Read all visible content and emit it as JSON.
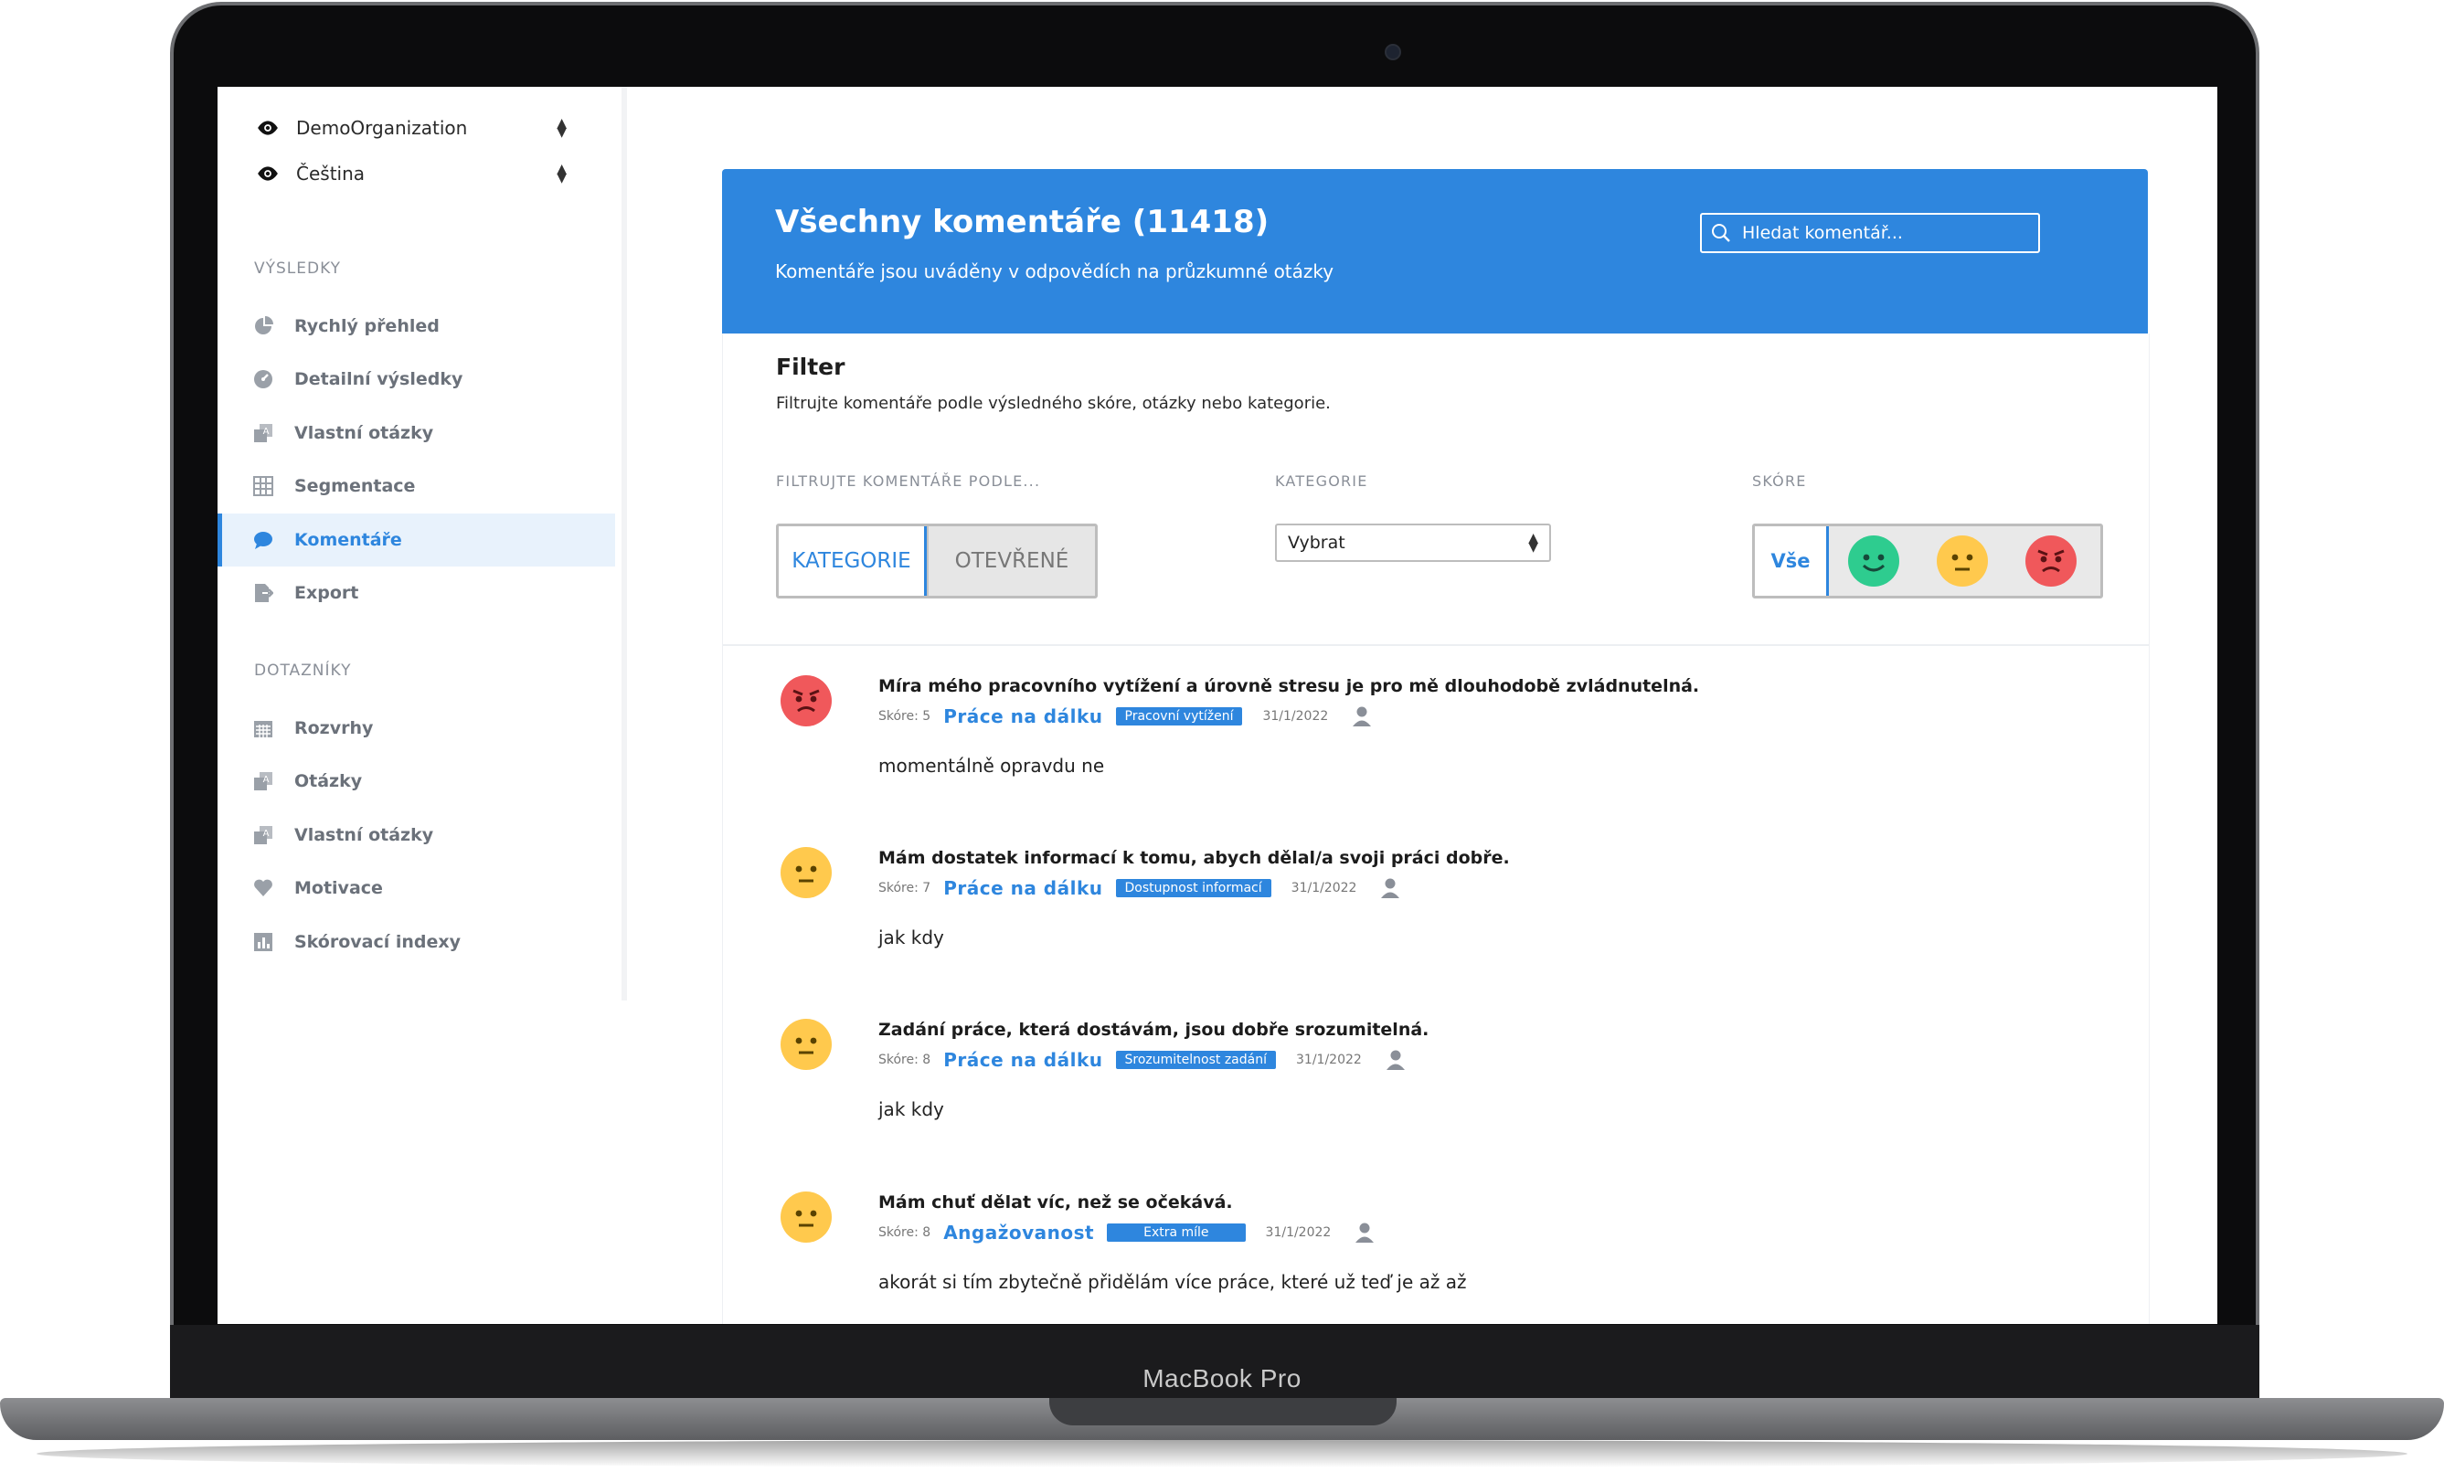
{
  "device": {
    "brand_label": "MacBook Pro"
  },
  "sidebar": {
    "org": "DemoOrganization",
    "language": "Čeština",
    "sections": [
      {
        "title": "VÝSLEDKY",
        "items": [
          {
            "label": "Rychlý přehled",
            "icon": "pie-chart-icon"
          },
          {
            "label": "Detailní výsledky",
            "icon": "gauge-icon"
          },
          {
            "label": "Vlastní otázky",
            "icon": "custom-question-icon"
          },
          {
            "label": "Segmentace",
            "icon": "grid-icon"
          },
          {
            "label": "Komentáře",
            "icon": "comment-icon",
            "active": true
          },
          {
            "label": "Export",
            "icon": "export-icon"
          }
        ]
      },
      {
        "title": "DOTAZNÍKY",
        "items": [
          {
            "label": "Rozvrhy",
            "icon": "calendar-icon"
          },
          {
            "label": "Otázky",
            "icon": "question-icon"
          },
          {
            "label": "Vlastní otázky",
            "icon": "custom-question-icon"
          },
          {
            "label": "Motivace",
            "icon": "heart-icon"
          },
          {
            "label": "Skórovací indexy",
            "icon": "bar-chart-icon"
          }
        ]
      }
    ]
  },
  "header": {
    "title": "Všechny komentáře (11418)",
    "subtitle": "Komentáře jsou uváděny v odpovědích na průzkumné otázky",
    "search_placeholder": "Hledat komentář..."
  },
  "filter": {
    "title": "Filter",
    "subtitle": "Filtrujte komentáře podle výsledného skóre, otázky nebo kategorie.",
    "by_label": "FILTRUJTE KOMENTÁŘE PODLE...",
    "by_options": [
      "KATEGORIE",
      "OTEVŘENÉ"
    ],
    "by_selected": "KATEGORIE",
    "category_label": "KATEGORIE",
    "category_value": "Vybrat",
    "score_label": "SKÓRE",
    "score_all": "Vše",
    "score_faces": [
      "happy-face-icon",
      "neutral-face-icon",
      "angry-face-icon"
    ],
    "colors": {
      "happy": "#2ecc8f",
      "neutral": "#ffc94d",
      "angry": "#f0585b",
      "accent": "#2e86de"
    }
  },
  "comments": [
    {
      "mood": "angry",
      "question": "Míra mého pracovního vytížení a úrovně stresu je pro mě dlouhodobě zvládnutelná.",
      "score": "Skóre: 5",
      "category": "Práce na dálku",
      "tag": "Pracovní vytížení",
      "date": "31/1/2022",
      "text": "momentálně opravdu ne"
    },
    {
      "mood": "neutral",
      "question": "Mám dostatek informací k tomu, abych dělal/a svoji práci dobře.",
      "score": "Skóre: 7",
      "category": "Práce na dálku",
      "tag": "Dostupnost informací",
      "date": "31/1/2022",
      "text": "jak kdy"
    },
    {
      "mood": "neutral",
      "question": "Zadání práce, která dostávám, jsou dobře srozumitelná.",
      "score": "Skóre: 8",
      "category": "Práce na dálku",
      "tag": "Srozumitelnost zadání",
      "date": "31/1/2022",
      "text": "jak kdy"
    },
    {
      "mood": "neutral",
      "question": "Mám chuť dělat víc, než se očekává.",
      "score": "Skóre: 8",
      "category": "Angažovanost",
      "tag": "Extra míle",
      "date": "31/1/2022",
      "text": "akorát si tím zbytečně přidělám více práce, které už teď je až až"
    }
  ]
}
